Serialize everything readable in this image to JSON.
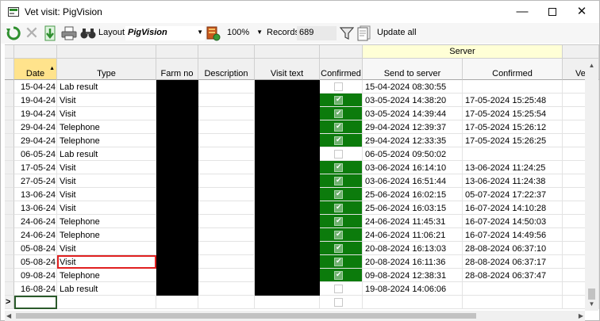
{
  "window": {
    "title": "Vet visit: PigVision",
    "minimize_glyph": "—",
    "close_glyph": "✕"
  },
  "toolbar": {
    "refresh_icon": "refresh-icon",
    "layout_label": "Layout",
    "layout_value": "PigVision",
    "zoom_value": "100%",
    "records_label": "Records",
    "records_value": "689",
    "update_label": "Update all",
    "dropdown_glyph": "▼"
  },
  "grid": {
    "group_header": "Server",
    "columns": [
      "Date",
      "Type",
      "Farm no",
      "Description",
      "Visit text",
      "Confirmed",
      "Send to server",
      "Confirmed",
      "Vet"
    ],
    "sort_glyph": "▲",
    "new_row_marker": ">",
    "rows": [
      {
        "date": "15-04-24",
        "type": "Lab result",
        "confirmed": false,
        "send": "15-04-2024 08:30:55",
        "server_confirmed": ""
      },
      {
        "date": "19-04-24",
        "type": "Visit",
        "confirmed": true,
        "send": "03-05-2024 14:38:20",
        "server_confirmed": "17-05-2024 15:25:48"
      },
      {
        "date": "19-04-24",
        "type": "Visit",
        "confirmed": true,
        "send": "03-05-2024 14:39:44",
        "server_confirmed": "17-05-2024 15:25:54"
      },
      {
        "date": "29-04-24",
        "type": "Telephone",
        "confirmed": true,
        "send": "29-04-2024 12:39:37",
        "server_confirmed": "17-05-2024 15:26:12"
      },
      {
        "date": "29-04-24",
        "type": "Telephone",
        "confirmed": true,
        "send": "29-04-2024 12:33:35",
        "server_confirmed": "17-05-2024 15:26:25"
      },
      {
        "date": "06-05-24",
        "type": "Lab result",
        "confirmed": false,
        "send": "06-05-2024 09:50:02",
        "server_confirmed": ""
      },
      {
        "date": "17-05-24",
        "type": "Visit",
        "confirmed": true,
        "send": "03-06-2024 16:14:10",
        "server_confirmed": "13-06-2024 11:24:25"
      },
      {
        "date": "27-05-24",
        "type": "Visit",
        "confirmed": true,
        "send": "03-06-2024 16:51:44",
        "server_confirmed": "13-06-2024 11:24:38"
      },
      {
        "date": "13-06-24",
        "type": "Visit",
        "confirmed": true,
        "send": "25-06-2024 16:02:15",
        "server_confirmed": "05-07-2024 17:22:37"
      },
      {
        "date": "13-06-24",
        "type": "Visit",
        "confirmed": true,
        "send": "25-06-2024 16:03:15",
        "server_confirmed": "16-07-2024 14:10:28"
      },
      {
        "date": "24-06-24",
        "type": "Telephone",
        "confirmed": true,
        "send": "24-06-2024 11:45:31",
        "server_confirmed": "16-07-2024 14:50:03"
      },
      {
        "date": "24-06-24",
        "type": "Telephone",
        "confirmed": true,
        "send": "24-06-2024 11:06:21",
        "server_confirmed": "16-07-2024 14:49:56"
      },
      {
        "date": "05-08-24",
        "type": "Visit",
        "confirmed": true,
        "send": "20-08-2024 16:13:03",
        "server_confirmed": "28-08-2024 06:37:10"
      },
      {
        "date": "05-08-24",
        "type": "Visit",
        "confirmed": true,
        "send": "20-08-2024 16:11:36",
        "server_confirmed": "28-08-2024 06:37:17"
      },
      {
        "date": "09-08-24",
        "type": "Telephone",
        "confirmed": true,
        "send": "09-08-2024 12:38:31",
        "server_confirmed": "28-08-2024 06:37:47"
      },
      {
        "date": "16-08-24",
        "type": "Lab result",
        "confirmed": false,
        "send": "19-08-2024 14:06:06",
        "server_confirmed": ""
      }
    ]
  },
  "colors": {
    "confirmed_green": "#0c7b0c",
    "date_header": "#ffe38c",
    "server_header": "#ffffd6",
    "highlight": "#e02020"
  }
}
